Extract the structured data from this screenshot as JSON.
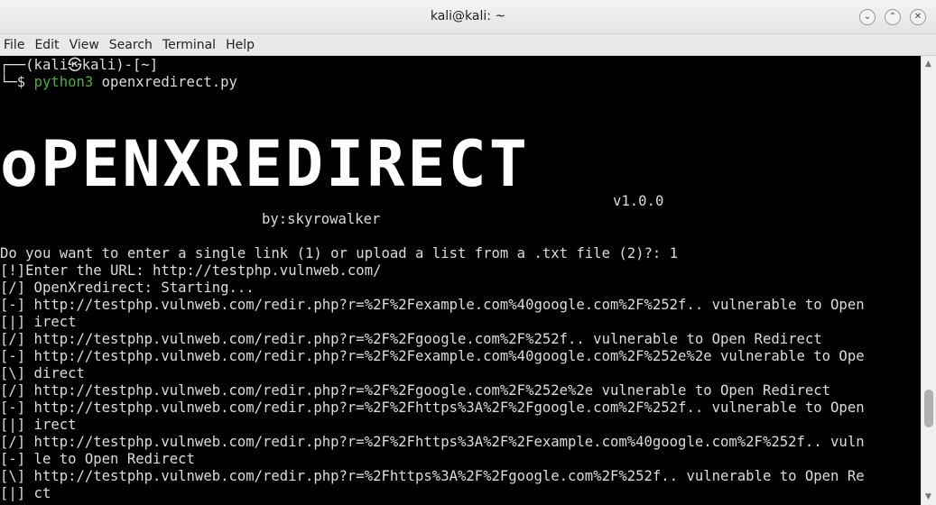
{
  "window": {
    "title": "kali@kali: ~",
    "buttons": [
      "minimize",
      "maximize",
      "close"
    ]
  },
  "menu": [
    "File",
    "Edit",
    "View",
    "Search",
    "Terminal",
    "Help"
  ],
  "prompt": {
    "line1": "┌──(kali㉿kali)-[~]",
    "line2_prefix": "└─$ ",
    "command_name": "python3",
    "command_args": " openxredirect.py"
  },
  "banner": {
    "art_text": "oPENXREDIRECT",
    "version": "v1.0.0",
    "author": "by:skyrowalker"
  },
  "output": [
    "Do you want to enter a single link (1) or upload a list from a .txt file (2)?: 1",
    "[!]Enter the URL: http://testphp.vulnweb.com/",
    "[/] OpenXredirect: Starting...",
    "[-] http://testphp.vulnweb.com/redir.php?r=%2F%2Fexample.com%40google.com%2F%252f.. vulnerable to Open",
    "[|] irect",
    "[/] http://testphp.vulnweb.com/redir.php?r=%2F%2Fgoogle.com%2F%252f.. vulnerable to Open Redirect",
    "[-] http://testphp.vulnweb.com/redir.php?r=%2F%2Fexample.com%40google.com%2F%252e%2e vulnerable to Ope",
    "[\\] direct",
    "[/] http://testphp.vulnweb.com/redir.php?r=%2F%2Fgoogle.com%2F%252e%2e vulnerable to Open Redirect",
    "[-] http://testphp.vulnweb.com/redir.php?r=%2F%2Fhttps%3A%2F%2Fgoogle.com%2F%252f.. vulnerable to Open",
    "[|] irect",
    "[/] http://testphp.vulnweb.com/redir.php?r=%2F%2Fhttps%3A%2F%2Fexample.com%40google.com%2F%252f.. vuln",
    "[-] le to Open Redirect",
    "[\\] http://testphp.vulnweb.com/redir.php?r=%2Fhttps%3A%2F%2Fgoogle.com%2F%252f.. vulnerable to Open Re",
    "[|] ct"
  ]
}
